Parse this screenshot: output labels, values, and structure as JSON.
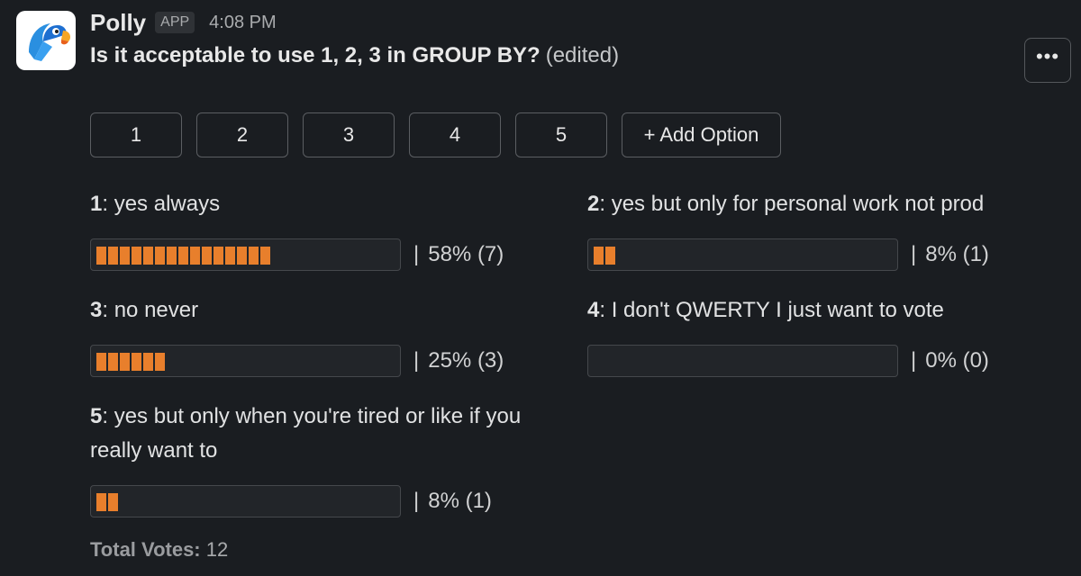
{
  "header": {
    "app_name": "Polly",
    "badge": "APP",
    "time": "4:08 PM"
  },
  "poll": {
    "question": "Is it acceptable to use 1, 2, 3 in GROUP BY?",
    "edited": "(edited)",
    "more_label": "•••",
    "option_buttons": [
      "1",
      "2",
      "3",
      "4",
      "5"
    ],
    "add_option_label": "+ Add Option",
    "results": [
      {
        "num": "1",
        "sep": ":",
        "text": " yes always",
        "pipe": "|",
        "percent_label": "58% (7)",
        "percent": 58,
        "votes": 7
      },
      {
        "num": "2",
        "sep": ":",
        "text": " yes but only for personal work not prod",
        "pipe": "|",
        "percent_label": "8% (1)",
        "percent": 8,
        "votes": 1
      },
      {
        "num": "3",
        "sep": ":",
        "text": " no never",
        "pipe": "|",
        "percent_label": "25% (3)",
        "percent": 25,
        "votes": 3
      },
      {
        "num": "4",
        "sep": ":",
        "text": " I don't QWERTY I just want to vote",
        "pipe": "|",
        "percent_label": "0% (0)",
        "percent": 0,
        "votes": 0
      },
      {
        "num": "5",
        "sep": ":",
        "text": " yes but only when you're tired or like if you really want to",
        "pipe": "|",
        "percent_label": "8% (1)",
        "percent": 8,
        "votes": 1
      }
    ],
    "total_label": "Total Votes:",
    "total_value": "12"
  },
  "colors": {
    "background": "#1a1d21",
    "bar_fill": "#e87f2c",
    "bar_track": "#222529"
  }
}
